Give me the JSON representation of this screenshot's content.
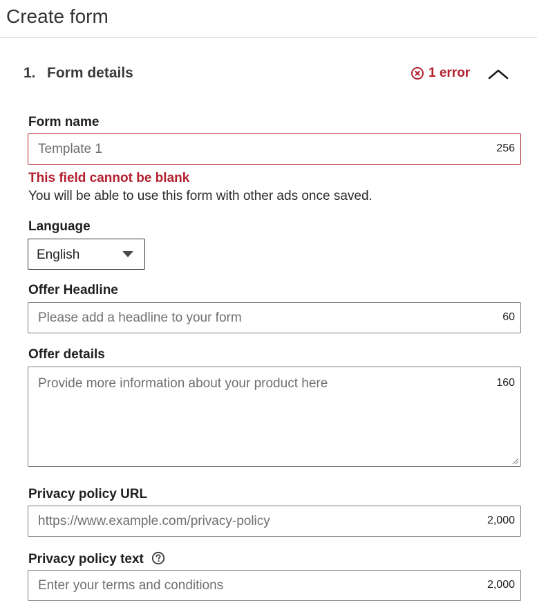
{
  "page": {
    "title": "Create form"
  },
  "section": {
    "number": "1.",
    "title": "Form details",
    "error_count_label": "1 error",
    "expanded": true
  },
  "fields": {
    "form_name": {
      "label": "Form name",
      "value": "",
      "placeholder": "Template 1",
      "char_count": "256",
      "error": "This field cannot be blank",
      "helper": "You will be able to use this form with other ads once saved."
    },
    "language": {
      "label": "Language",
      "selected": "English"
    },
    "offer_headline": {
      "label": "Offer Headline",
      "value": "",
      "placeholder": "Please add a headline to your form",
      "char_count": "60"
    },
    "offer_details": {
      "label": "Offer details",
      "value": "",
      "placeholder": "Provide more information about your product here",
      "char_count": "160"
    },
    "privacy_url": {
      "label": "Privacy policy URL",
      "value": "",
      "placeholder": "https://www.example.com/privacy-policy",
      "char_count": "2,000"
    },
    "privacy_text": {
      "label": "Privacy policy text",
      "value": "",
      "placeholder": "Enter your terms and conditions",
      "char_count": "2,000"
    }
  },
  "icons": {
    "error": "error-circle-x-icon",
    "collapse": "chevron-up-icon",
    "dropdown": "caret-down-icon",
    "help": "question-circle-icon"
  },
  "colors": {
    "error": "#b31f2e",
    "border": "#7a7a7a",
    "text": "#1f1f1f"
  }
}
